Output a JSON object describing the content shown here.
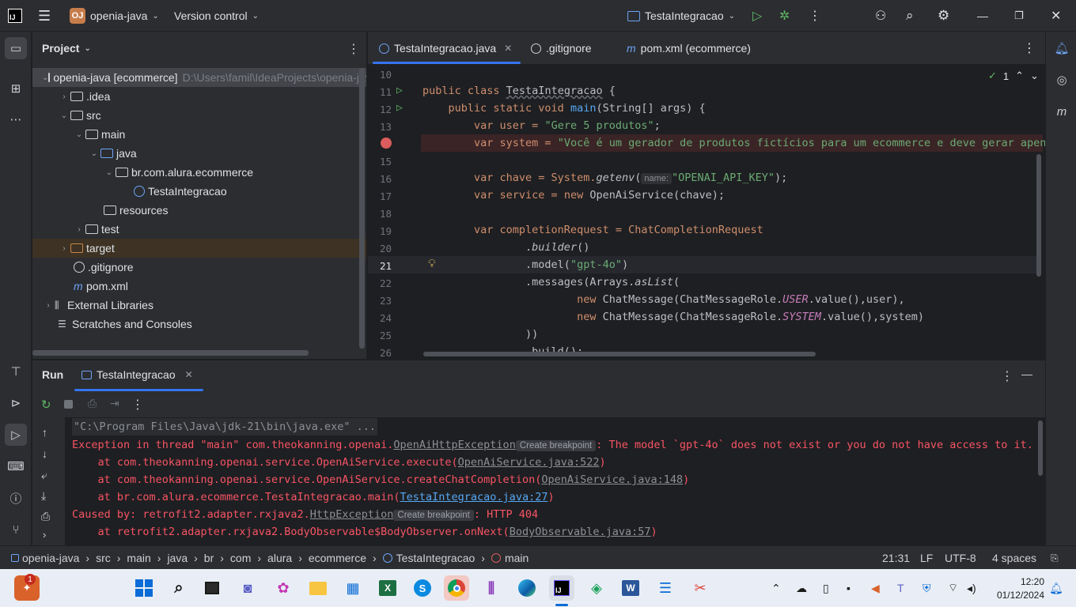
{
  "titlebar": {
    "project_badge": "OJ",
    "project_name": "openia-java",
    "vcs": "Version control",
    "run_config": "TestaIntegracao"
  },
  "project_panel": {
    "title": "Project",
    "tree": [
      {
        "label": "openia-java [ecommerce]",
        "path": "D:\\Users\\famil\\IdeaProjects\\openia-java"
      },
      {
        "label": ".idea"
      },
      {
        "label": "src"
      },
      {
        "label": "main"
      },
      {
        "label": "java"
      },
      {
        "label": "br.com.alura.ecommerce"
      },
      {
        "label": "TestaIntegracao"
      },
      {
        "label": "resources"
      },
      {
        "label": "test"
      },
      {
        "label": "target"
      },
      {
        "label": ".gitignore"
      },
      {
        "label": "pom.xml"
      },
      {
        "label": "External Libraries"
      },
      {
        "label": "Scratches and Consoles"
      }
    ]
  },
  "editor": {
    "tabs": [
      {
        "label": "TestaIntegracao.java"
      },
      {
        "label": ".gitignore"
      },
      {
        "label": "pom.xml (ecommerce)"
      }
    ],
    "inspection_count": "1",
    "line_numbers": [
      "10",
      "11",
      "12",
      "13",
      "14",
      "15",
      "16",
      "17",
      "18",
      "19",
      "20",
      "21",
      "22",
      "23",
      "24",
      "25",
      "26"
    ],
    "param_hint": "name:",
    "code": {
      "l11a": "public class ",
      "l11b": "TestaIntegracao",
      "l11c": " {",
      "l12a": "    public static void ",
      "l12b": "main",
      "l12c": "(String[] args) {",
      "l13a": "        var user = ",
      "l13b": "\"Gere 5 produtos\"",
      "l13c": ";",
      "l14a": "        var system = ",
      "l14b": "\"Você é um gerador de produtos fictícios para um ecommerce e deve gerar apena",
      "l16a": "        var chave = System.",
      "l16b": "getenv",
      "l16c": "(",
      "l16d": "\"OPENAI_API_KEY\"",
      "l16e": ");",
      "l17a": "        var service = ",
      "l17b": "new",
      "l17c": " OpenAiService(chave);",
      "l19a": "        var completionRequest = ChatCompletionRequest",
      "l20a": "                .",
      "l20b": "builder",
      "l20c": "()",
      "l21a": "                .model(",
      "l21b": "\"gpt-4o\"",
      "l21c": ")",
      "l22a": "                .messages(Arrays.",
      "l22b": "asList",
      "l22c": "(",
      "l23a": "                        ",
      "l23b": "new",
      "l23c": " ChatMessage(ChatMessageRole.",
      "l23d": "USER",
      "l23e": ".value(),user),",
      "l24a": "                        ",
      "l24b": "new",
      "l24c": " ChatMessage(ChatMessageRole.",
      "l24d": "SYSTEM",
      "l24e": ".value(),system)",
      "l25a": "                ))",
      "l26a": "                .build();"
    }
  },
  "run_panel": {
    "title": "Run",
    "tab": "TestaIntegracao",
    "create_breakpoint": "Create breakpoint",
    "console": {
      "c1": "\"C:\\Program Files\\Java\\jdk-21\\bin\\java.exe\" ...",
      "c2a": "Exception in thread \"main\" com.theokanning.openai.",
      "c2b": "OpenAiHttpException",
      "c2c": ": The model `gpt-4o` does not exist or you do not have access to it.",
      "c3a": "    at com.theokanning.openai.service.OpenAiService.execute(",
      "c3b": "OpenAiService.java:522",
      "c3c": ")",
      "c4a": "    at com.theokanning.openai.service.OpenAiService.createChatCompletion(",
      "c4b": "OpenAiService.java:148",
      "c4c": ")",
      "c5a": "    at br.com.alura.ecommerce.TestaIntegracao.main(",
      "c5b": "TestaIntegracao.java:27",
      "c5c": ")",
      "c6a": "Caused by: retrofit2.adapter.rxjava2.",
      "c6b": "HttpException",
      "c6c": ": HTTP 404",
      "c7a": "    at retrofit2.adapter.rxjava2.BodyObservable$BodyObserver.onNext(",
      "c7b": "BodyObservable.java:57",
      "c7c": ")"
    }
  },
  "statusbar": {
    "breadcrumbs": [
      "openia-java",
      "src",
      "main",
      "java",
      "br",
      "com",
      "alura",
      "ecommerce",
      "TestaIntegracao",
      "main"
    ],
    "position": "21:31",
    "line_sep": "LF",
    "encoding": "UTF-8",
    "indent": "4 spaces"
  },
  "taskbar": {
    "notif_count": "1",
    "time": "12:20",
    "date": "01/12/2024"
  },
  "colors": {
    "accent": "#3574f0",
    "error": "#f75464",
    "keyword": "#cf8e6d",
    "string": "#6aab73"
  }
}
